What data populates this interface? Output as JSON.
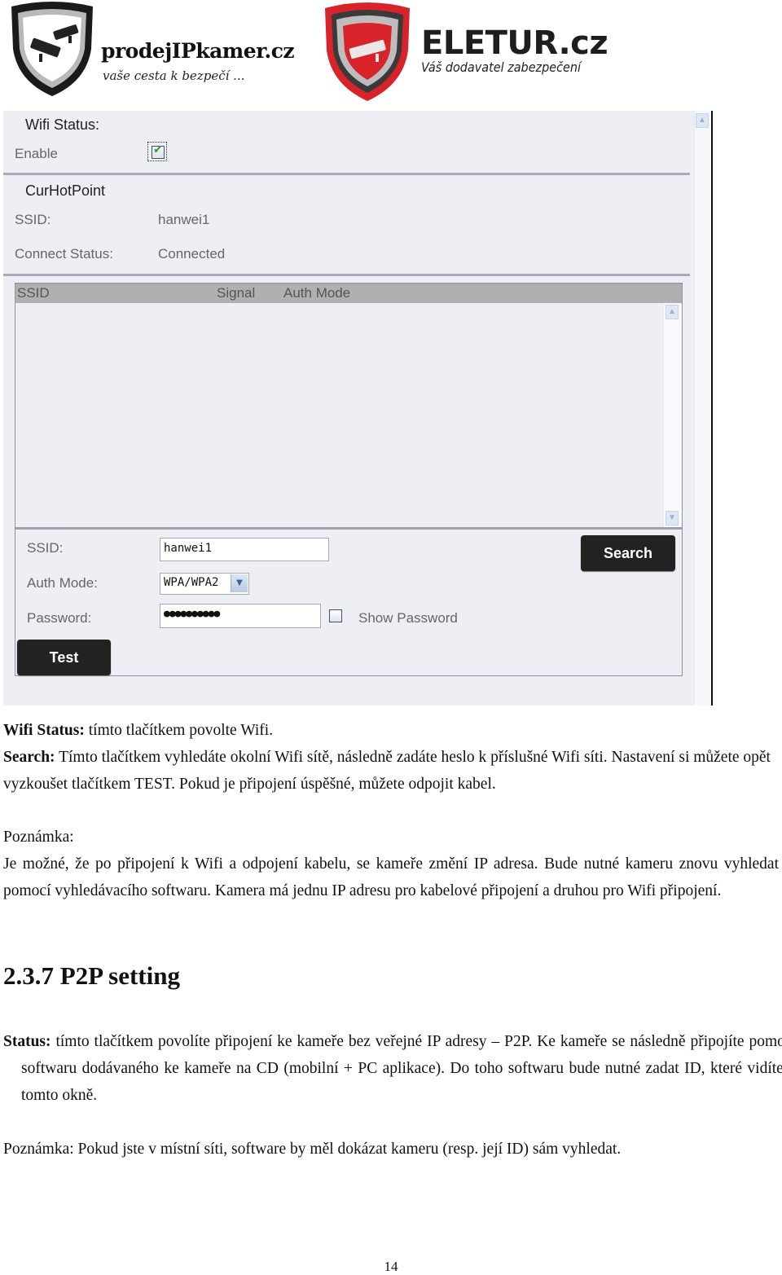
{
  "header": {
    "brand_a": {
      "name": "prodejIPkamer.cz",
      "tagline": "vaše cesta k bezpečí ..."
    },
    "brand_b": {
      "name": "ELETUR.cz",
      "tagline": "Váš dodavatel zabezpečení"
    },
    "colors": {
      "brand_b_red": "#d8232a",
      "shield_dark": "#1a1a1a"
    }
  },
  "wifi_panel": {
    "wifi_status": {
      "title": "Wifi Status:",
      "enable_label": "Enable",
      "enable_checked": true
    },
    "cur_hot_point": {
      "title": "CurHotPoint",
      "ssid_label": "SSID:",
      "ssid_value": "hanwei1",
      "connect_status_label": "Connect Status:",
      "connect_status_value": "Connected"
    },
    "network_table": {
      "columns": [
        "SSID",
        "Signal",
        "Auth Mode"
      ],
      "rows": []
    },
    "form": {
      "ssid_label": "SSID:",
      "ssid_value": "hanwei1",
      "auth_mode_label": "Auth Mode:",
      "auth_mode_value": "WPA/WPA2",
      "password_label": "Password:",
      "password_value": "●●●●●●●●●●",
      "show_password_label": "Show Password",
      "show_password_checked": false,
      "search_button": "Search",
      "test_button": "Test"
    },
    "icons": {
      "scroll_up": "▲",
      "scroll_down": "▼",
      "select_arrow": "▼",
      "check": "✔"
    }
  },
  "document": {
    "wifi_status_term": "Wifi Status:",
    "wifi_status_text": " tímto tlačítkem povolte Wifi.",
    "search_term": "Search:",
    "search_text": " Tímto tlačítkem vyhledáte okolní Wifi sítě, následně zadáte heslo k příslušné Wifi síti. Nastavení si můžete opět vyzkoušet tlačítkem TEST. Pokud je připojení úspěšné, můžete odpojit kabel.",
    "note1_title": "Poznámka:",
    "note1_text": "Je možné, že po připojení k Wifi a odpojení kabelu, se kameře změní IP adresa. Bude nutné kameru znovu vyhledat pomocí vyhledávacího softwaru. Kamera má jednu IP adresu pro kabelové připojení a druhou pro Wifi připojení.",
    "section_heading": "2.3.7 P2P setting",
    "status_term": "Status:",
    "status_text": " tímto tlačítkem povolíte připojení ke kameře bez veřejné IP adresy – P2P. Ke kameře se následně připojíte pomocí softwaru dodávaného ke kameře na CD (mobilní + PC aplikace). Do toho softwaru bude nutné zadat ID, které vidíte v tomto okně.",
    "note2_text": "Poznámka: Pokud jste v místní síti, software by měl dokázat kameru (resp. její ID) sám vyhledat.",
    "page_number": "14"
  }
}
